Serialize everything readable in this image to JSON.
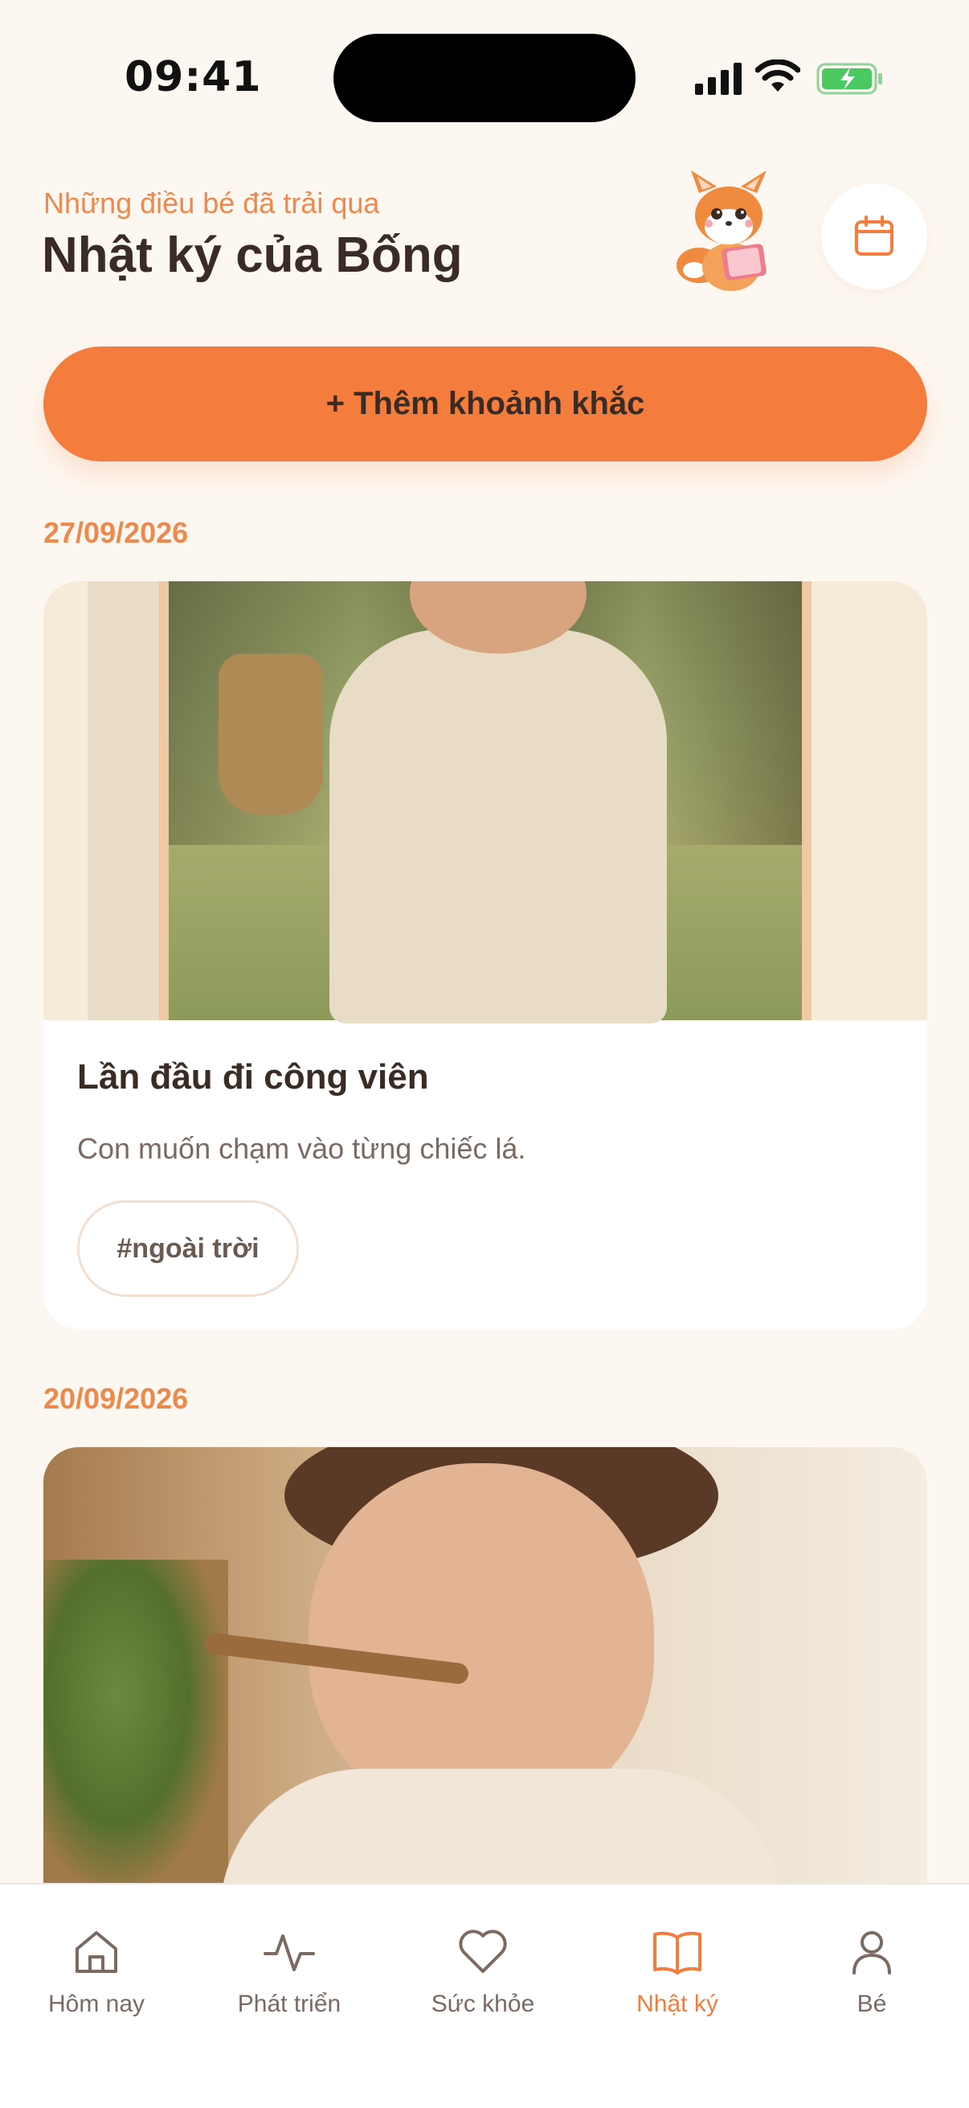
{
  "status_bar": {
    "time": "09:41"
  },
  "header": {
    "subtitle": "Những điều bé đã trải qua",
    "title": "Nhật ký của Bống"
  },
  "actions": {
    "add_moment": "+ Thêm khoảnh khắc"
  },
  "entries": [
    {
      "date": "27/09/2026",
      "title": "Lần đầu đi công viên",
      "description": "Con muốn chạm vào từng chiếc lá.",
      "tag": "#ngoài trời"
    },
    {
      "date": "20/09/2026"
    }
  ],
  "tab_bar": {
    "items": [
      {
        "label": "Hôm nay",
        "icon": "home-icon"
      },
      {
        "label": "Phát triển",
        "icon": "activity-icon"
      },
      {
        "label": "Sức khỏe",
        "icon": "heart-icon"
      },
      {
        "label": "Nhật ký",
        "icon": "book-icon",
        "active": true
      },
      {
        "label": "Bé",
        "icon": "user-icon"
      }
    ]
  },
  "colors": {
    "accent": "#f47c3d",
    "background": "#fdf7f1",
    "text": "#3a2b25"
  }
}
